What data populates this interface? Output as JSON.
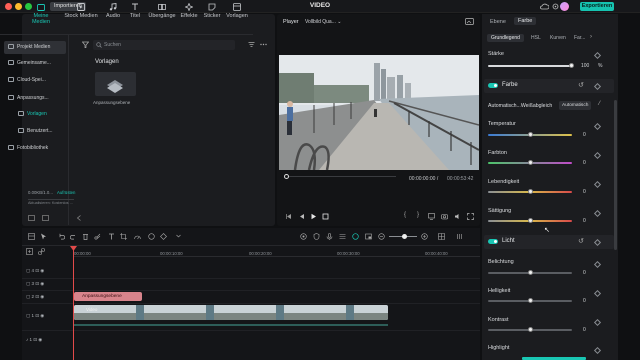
{
  "title_bar": {
    "import_label": "Importieren",
    "app_title": "VIDEO",
    "export_label": "Exportieren"
  },
  "media_tabs": [
    {
      "label": "Meine Medien",
      "icon": "folder-icon"
    },
    {
      "label": "Stock Medien",
      "icon": "play-square-icon"
    },
    {
      "label": "Audio",
      "icon": "music-note-icon"
    },
    {
      "label": "Titel",
      "icon": "text-t-icon"
    },
    {
      "label": "Übergänge",
      "icon": "transition-icon"
    },
    {
      "label": "Effekte",
      "icon": "sparkle-icon"
    },
    {
      "label": "Sticker",
      "icon": "sticker-icon"
    },
    {
      "label": "Vorlagen",
      "icon": "template-icon"
    }
  ],
  "media_tree": {
    "items": [
      "Projekt Medien",
      "Gemeinsame...",
      "Cloud-Spei...",
      "Anpassungs...",
      "Vorlagen",
      "Benutzert...",
      "Fotobibliothek"
    ]
  },
  "library": {
    "search_placeholder": "Suchen",
    "section_title": "Vorlagen",
    "thumb_label": "Anpassungsebene",
    "storage_text": "0.00KB/1.0...",
    "storage_action": "Aufrüsten",
    "storage_sub": "Aktualisieren: Kostenlos ..."
  },
  "player": {
    "tab_label": "Player",
    "quality": "Vollbild Qua...",
    "time_current": "00:00:00:00",
    "time_sep": "/",
    "time_total": "00:00:53:42",
    "progress_fraction": 0.0
  },
  "right_panel": {
    "tabs": [
      "Ebene",
      "Farbe"
    ],
    "active_tab": "Farbe",
    "sub_tabs": [
      "Grundlegend",
      "HSL",
      "Kurven",
      "Far..."
    ],
    "staerke_label": "Stärke",
    "staerke_value": "100",
    "staerke_unit": "%",
    "farbe_title": "Farbe",
    "auto_wb_label": "Automatisch...Weißabgleich",
    "auto_button": "Automatisch",
    "temperatur_label": "Temperatur",
    "temperatur_value": "0",
    "farbton_label": "Farbton",
    "farbton_value": "0",
    "lebendigkeit_label": "Lebendigkeit",
    "lebendigkeit_value": "0",
    "saettigung_label": "Sättigung",
    "saettigung_value": "0",
    "licht_title": "Licht",
    "belichtung_label": "Belichtung",
    "belichtung_value": "0",
    "helligkeit_label": "Helligkeit",
    "helligkeit_value": "0",
    "kontrast_label": "Kontrast",
    "kontrast_value": "0",
    "highlight_label": "Highlight"
  },
  "timeline": {
    "ruler": [
      "00:00:00",
      "00:00:10:00",
      "00:00:20:00",
      "00:00:30:00",
      "00:00:40:00",
      "00:00:50:00"
    ],
    "tracks": [
      "4",
      "3",
      "2",
      "1",
      "1"
    ],
    "adjustment_clip": "Anpassungsebene",
    "video_clip": "Video"
  },
  "colors": {
    "accent": "#19c6b3",
    "playhead": "#e24a4a",
    "adjustment_clip": "#d8848c"
  }
}
